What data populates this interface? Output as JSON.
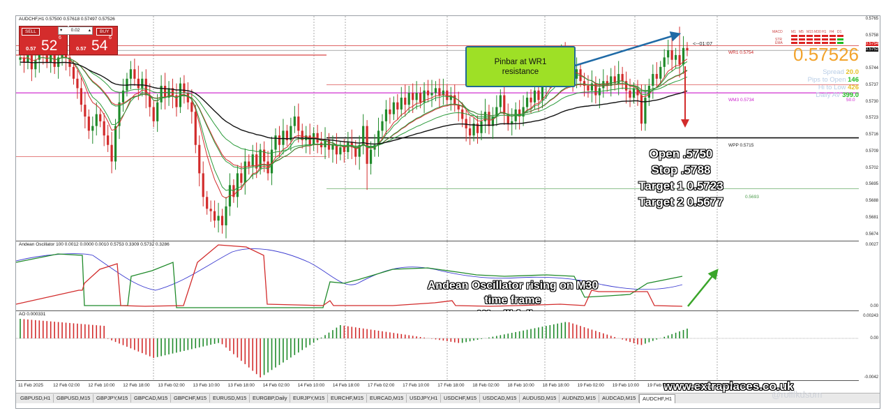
{
  "symbol_title": "AUDCHF,H1  0.57500 0.57618 0.57497 0.57526",
  "trade_panel": {
    "sell_label": "SELL",
    "buy_label": "BUY",
    "lot": "0.02",
    "sell_prefix": "0.57",
    "sell_big": "52",
    "sell_sup": "6",
    "buy_prefix": "0.57",
    "buy_big": "54",
    "buy_sup": "6"
  },
  "countdown": "<--01:07",
  "info": {
    "mtf_headers": [
      "MACD",
      "M1",
      "M5",
      "M15",
      "M30",
      "H1",
      "H4",
      "D1"
    ],
    "mtf_rows": [
      "STR",
      "EMA"
    ],
    "price": "0.57526",
    "spread_label": "Spread",
    "spread_value": "20.0",
    "pips_label": "Pips to Open",
    "pips_value": "146",
    "hilo_label": "Hi to Low",
    "hilo_value": "426",
    "daily_label": "Daily AV",
    "daily_value": "399.0",
    "colors": {
      "price": "#f2a32c",
      "spread": "#e6c22a",
      "pips": "#22bb22",
      "hilo": "#e6c22a",
      "daily": "#22bb22"
    }
  },
  "levels": {
    "wr1": "WR1 0.5754",
    "wm3": "WM3 0.5734",
    "wpp": "WPP 0.5715",
    "low": "0.5693",
    "wm3_right": "50.0"
  },
  "price_scale": [
    "0.5765",
    "0.5758",
    "0.5754",
    "0.5752",
    "0.5744",
    "0.5737",
    "0.5730",
    "0.5723",
    "0.5716",
    "0.5709",
    "0.5702",
    "0.5695",
    "0.5688",
    "0.5681",
    "0.5674"
  ],
  "callout": {
    "line1": "Pinbar at WR1",
    "line2": "resistance"
  },
  "trade_plan": [
    "Open .5750",
    "Stop .5788",
    "Target 1 0.5723",
    "Target 2 0.5677"
  ],
  "oscillator": {
    "title": "Andean Oscillator 100 0.0012 0.0000 0.0010 0.5753 0.3309 0.5732 0.3286",
    "scale_top": "0.0027",
    "scale_bottom": "0.00",
    "note": [
      "Andean Oscillator rising on M30",
      "time frame",
      "H1 will follow"
    ]
  },
  "ao": {
    "title": "AO 0.000331",
    "scale_top": "0.00243",
    "scale_mid": "0.00",
    "scale_bottom": "-0.0042"
  },
  "website": "www.extraplaces.co.uk",
  "time_axis": [
    "11 Feb 2025",
    "12 Feb 02:00",
    "12 Feb 10:00",
    "12 Feb 18:00",
    "13 Feb 02:00",
    "13 Feb 10:00",
    "13 Feb 18:00",
    "14 Feb 02:00",
    "14 Feb 10:00",
    "14 Feb 18:00",
    "17 Feb 02:00",
    "17 Feb 10:00",
    "17 Feb 18:00",
    "18 Feb 02:00",
    "18 Feb 10:00",
    "18 Feb 18:00",
    "19 Feb 02:00",
    "19 Feb 10:00",
    "19 Feb 18:00",
    "20 Feb 02:00",
    "20 Feb 10:00"
  ],
  "tabs": [
    "GBPUSD,H1",
    "GBPUSD,M15",
    "GBPJPY,M15",
    "GBPCAD,M15",
    "GBPCHF,M15",
    "EURUSD,M15",
    "EURGBP,Daily",
    "EURJPY,M15",
    "EURCHF,M15",
    "EURCAD,M15",
    "USDJPY,H1",
    "USDCHF,M15",
    "USDCAD,M15",
    "AUDUSD,M15",
    "AUDNZD,M15",
    "AUDCAD,M15",
    "AUDCHF,H1"
  ],
  "active_tab": "AUDCHF,H1",
  "watermark": "@rollfkdsom",
  "candles": {
    "start_open": 0.5748,
    "closes": [
      0.5749,
      0.5747,
      0.575,
      0.5744,
      0.5748,
      0.5752,
      0.575,
      0.5747,
      0.575,
      0.5745,
      0.5749,
      0.5752,
      0.5749,
      0.5745,
      0.574,
      0.5736,
      0.5729,
      0.5724,
      0.5718,
      0.572,
      0.5725,
      0.5722,
      0.5716,
      0.5712,
      0.5705,
      0.572,
      0.573,
      0.5735,
      0.574,
      0.5744,
      0.574,
      0.5736,
      0.574,
      0.5733,
      0.5728,
      0.5722,
      0.573,
      0.5737,
      0.5732,
      0.5736,
      0.5733,
      0.5728,
      0.5738,
      0.5734,
      0.573,
      0.5726,
      0.5712,
      0.57,
      0.569,
      0.5685,
      0.5684,
      0.568,
      0.5682,
      0.5678,
      0.5686,
      0.5695,
      0.569,
      0.57,
      0.5696,
      0.5705,
      0.5703,
      0.5708,
      0.5702,
      0.571,
      0.5705,
      0.57,
      0.571,
      0.5716,
      0.5712,
      0.5718,
      0.5714,
      0.572,
      0.5724,
      0.5718,
      0.5714,
      0.5716,
      0.5712,
      0.5717,
      0.5713,
      0.5711,
      0.5714,
      0.571,
      0.5712,
      0.5708,
      0.5711,
      0.5709,
      0.5713,
      0.5711,
      0.5707,
      0.5712,
      0.572,
      0.5704,
      0.571,
      0.5712,
      0.5718,
      0.5722,
      0.5727,
      0.5725,
      0.573,
      0.5727,
      0.5732,
      0.5729,
      0.5734,
      0.5731,
      0.5734,
      0.573,
      0.5735,
      0.5733,
      0.5734,
      0.5736,
      0.5733,
      0.5735,
      0.5731,
      0.5733,
      0.5729,
      0.5727,
      0.5723,
      0.5719,
      0.5716,
      0.5721,
      0.5717,
      0.5722,
      0.5726,
      0.572,
      0.5724,
      0.5728,
      0.5733,
      0.5725,
      0.5721,
      0.5722,
      0.5727,
      0.5724,
      0.5728,
      0.5732,
      0.573,
      0.5735,
      0.5731,
      0.5737,
      0.574,
      0.5745,
      0.5742,
      0.5747,
      0.575,
      0.5746,
      0.5743,
      0.574,
      0.5744,
      0.5739,
      0.5737,
      0.5735,
      0.5738,
      0.5733,
      0.5736,
      0.5739,
      0.5737,
      0.5741,
      0.5738,
      0.5742,
      0.5739,
      0.5735,
      0.5732,
      0.5736,
      0.5733,
      0.5721,
      0.5732,
      0.5737,
      0.5742,
      0.574,
      0.5745,
      0.5749,
      0.5752,
      0.5748,
      0.575,
      0.5746,
      0.5753,
      0.5752
    ]
  }
}
